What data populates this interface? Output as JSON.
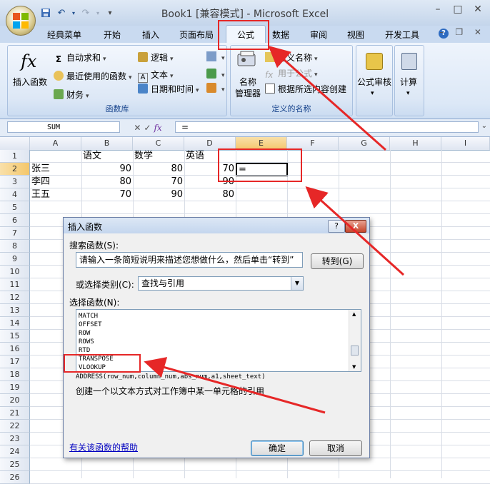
{
  "window": {
    "title": "Book1  [兼容模式] - Microsoft Excel",
    "controls": [
      "–",
      "□",
      "✕"
    ]
  },
  "ribbon_tabs": [
    "经典菜单",
    "开始",
    "插入",
    "页面布局",
    "公式",
    "数据",
    "审阅",
    "视图",
    "开发工具"
  ],
  "active_tab": "公式",
  "ribbon": {
    "library": {
      "insert_function": "插入函数",
      "autosum": "自动求和",
      "recent": "最近使用的函数",
      "financial": "财务",
      "logical": "逻辑",
      "text": "文本",
      "datetime": "日期和时间",
      "label": "函数库"
    },
    "names": {
      "name_manager_line1": "名称",
      "name_manager_line2": "管理器",
      "define_name": "定义名称",
      "use_in_formula": "用于公式",
      "create_from_selection": "根据所选内容创建",
      "label": "定义的名称"
    },
    "audit": "公式审核",
    "calc": "计算"
  },
  "formula_bar": {
    "name_box": "SUM",
    "content": "=",
    "fx": "fx"
  },
  "grid": {
    "columns": [
      "A",
      "B",
      "C",
      "D",
      "E",
      "F",
      "G",
      "H",
      "I"
    ],
    "rows": [
      "1",
      "2",
      "3",
      "4",
      "5",
      "6",
      "7",
      "8",
      "9",
      "10",
      "11",
      "12",
      "13",
      "14",
      "15",
      "16",
      "17",
      "18",
      "19",
      "20",
      "21",
      "22",
      "23",
      "24",
      "25",
      "26"
    ],
    "header_row": [
      "",
      "语文",
      "数学",
      "英语"
    ],
    "data": [
      {
        "name": "张三",
        "chinese": "90",
        "math": "80",
        "english": "70",
        "e": "="
      },
      {
        "name": "李四",
        "chinese": "80",
        "math": "70",
        "english": "90"
      },
      {
        "name": "王五",
        "chinese": "70",
        "math": "90",
        "english": "80"
      }
    ]
  },
  "dialog": {
    "title": "插入函数",
    "search_label": "搜索函数(S):",
    "search_value": "请输入一条简短说明来描述您想做什么，然后单击“转到”",
    "go_button": "转到(G)",
    "category_label": "或选择类别(C):",
    "category_value": "查找与引用",
    "function_label": "选择函数(N):",
    "functions": [
      "MATCH",
      "OFFSET",
      "ROW",
      "ROWS",
      "RTD",
      "TRANSPOSE",
      "VLOOKUP"
    ],
    "syntax": "ADDRESS(row_num,column_num,abs_num,a1,sheet_text)",
    "description": "创建一个以文本方式对工作簿中某一单元格的引用",
    "help_link": "有关该函数的帮助",
    "ok": "确定",
    "cancel": "取消",
    "help_btn": "?",
    "close_btn": "X"
  },
  "colors": {
    "annotation_red": "#e62727",
    "ribbon_blue": "#dce8f7"
  }
}
